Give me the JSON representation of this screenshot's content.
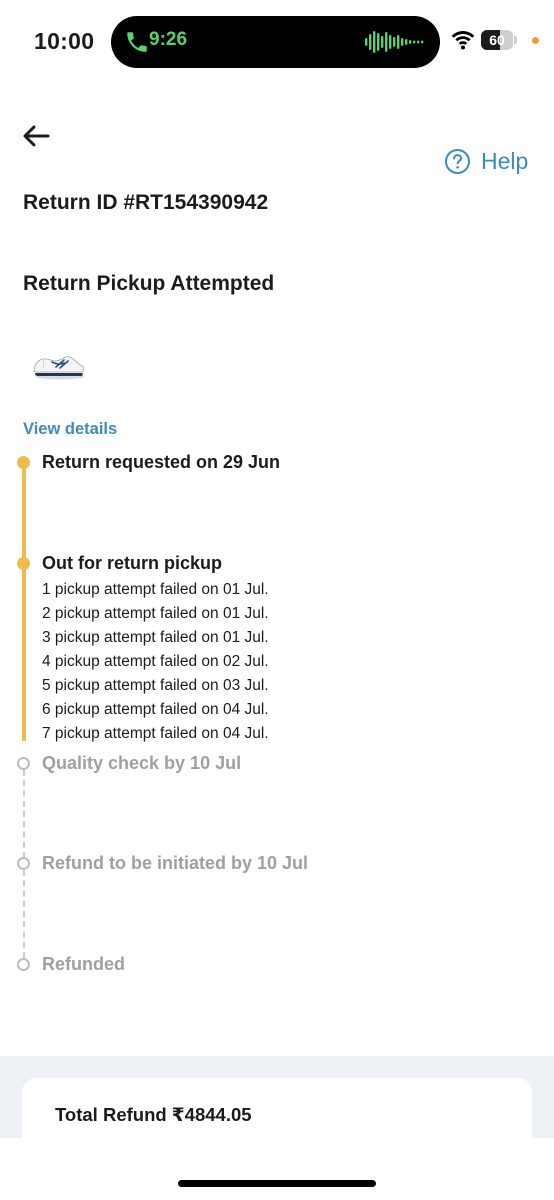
{
  "status_bar": {
    "time": "10:00",
    "call_time": "9:26",
    "battery_level": "60",
    "battery_fraction": 0.6
  },
  "header": {
    "back_icon": "arrow-left-icon",
    "help_icon": "question-circle-icon",
    "help_label": "Help"
  },
  "order": {
    "return_id": "Return ID #RT154390942",
    "status": "Return Pickup Attempted",
    "product_image": "sneaker-thumbnail",
    "view_details_label": "View details"
  },
  "timeline": {
    "steps": [
      {
        "title": "Return requested on 29 Jun",
        "state": "done"
      },
      {
        "title": "Out for return pickup",
        "state": "done"
      },
      {
        "title": "Quality check by 10 Jul",
        "state": "pending"
      },
      {
        "title": "Refund to be initiated by 10 Jul",
        "state": "pending"
      },
      {
        "title": "Refunded",
        "state": "pending"
      }
    ],
    "pickup_attempts": [
      "1 pickup attempt failed on 01 Jul.",
      "2 pickup attempt failed on 01 Jul.",
      "3 pickup attempt failed on 01 Jul.",
      "4 pickup attempt failed on 02 Jul.",
      "5 pickup attempt failed on 03 Jul.",
      "6 pickup attempt failed on 04 Jul.",
      "7 pickup attempt failed on 04 Jul."
    ]
  },
  "refund": {
    "total_label": "Total Refund ₹4844.05"
  },
  "colors": {
    "accent_link": "#3b8bbb",
    "timeline_done": "#efbb4a",
    "timeline_pending": "#bdbdbd",
    "call_green": "#59d26b"
  }
}
